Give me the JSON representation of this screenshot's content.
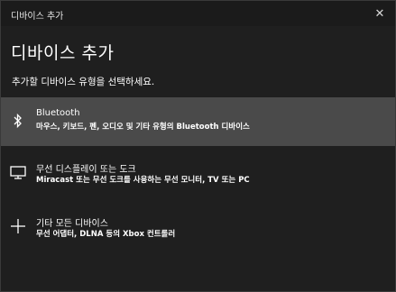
{
  "window": {
    "title": "디바이스 추가",
    "close_glyph": "✕"
  },
  "heading": "디바이스 추가",
  "subheading": "추가할 디바이스 유형을 선택하세요.",
  "options": [
    {
      "icon": "bluetooth-icon",
      "label": "Bluetooth",
      "desc": "마우스, 키보드, 펜, 오디오 및 기타 유형의 Bluetooth 디바이스",
      "selected": true
    },
    {
      "icon": "display-icon",
      "label": "무선 디스플레이 또는 도크",
      "desc": "Miracast 또는 무선 도크를 사용하는 무선 모니터, TV 또는 PC",
      "selected": false
    },
    {
      "icon": "plus-icon",
      "label": "기타 모든 디바이스",
      "desc": "무선 어댑터, DLNA 등의 Xbox 컨트롤러",
      "selected": false
    }
  ],
  "colors": {
    "background": "#1f1f1f",
    "selected_row": "#4a4a4a",
    "text": "#ffffff"
  }
}
